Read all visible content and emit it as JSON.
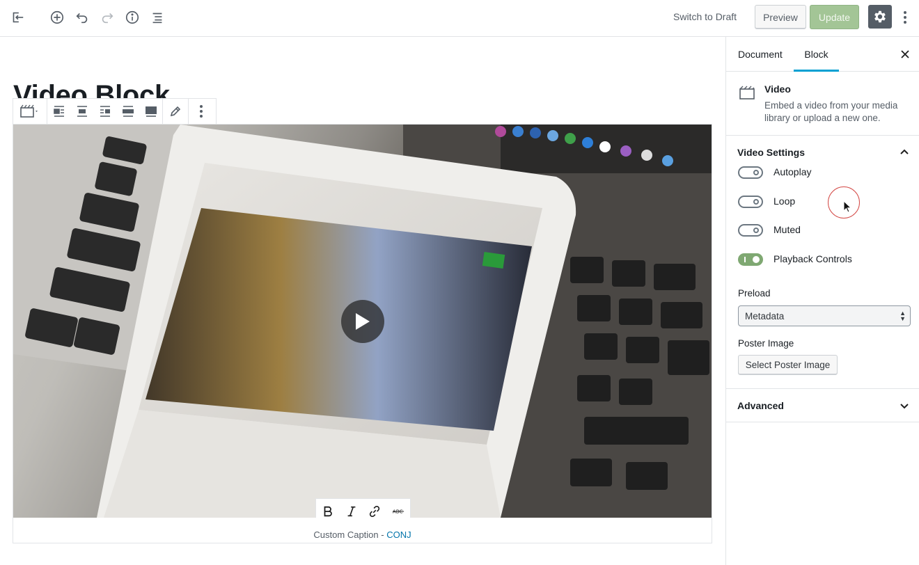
{
  "topbar": {
    "switch_to_draft": "Switch to Draft",
    "preview": "Preview",
    "update": "Update",
    "icons": [
      "back-icon",
      "add-block-icon",
      "undo-icon",
      "redo-icon",
      "info-icon",
      "outline-icon",
      "gear-icon",
      "more-vertical-icon"
    ]
  },
  "editor": {
    "post_title": "Video Block",
    "block_toolbar": [
      "video-icon",
      "align-left-icon",
      "align-center-icon",
      "align-right-icon",
      "wide-width-icon",
      "full-width-icon",
      "edit-pencil-icon",
      "more-vertical-icon"
    ],
    "caption_toolbar": [
      "bold-icon",
      "italic-icon",
      "link-icon",
      "strikethrough-icon"
    ],
    "caption_prefix": "Custom Caption - ",
    "caption_link": "CONJ"
  },
  "sidebar": {
    "tabs": [
      "Document",
      "Block"
    ],
    "active_tab": "Block",
    "block": {
      "name": "Video",
      "description": "Embed a video from your media library or upload a new one."
    },
    "video_settings": {
      "title": "Video Settings",
      "toggles": [
        {
          "label": "Autoplay",
          "on": false
        },
        {
          "label": "Loop",
          "on": false
        },
        {
          "label": "Muted",
          "on": false
        },
        {
          "label": "Playback Controls",
          "on": true
        }
      ],
      "preload_label": "Preload",
      "preload_value": "Metadata",
      "poster_label": "Poster Image",
      "poster_button": "Select Poster Image"
    },
    "advanced": {
      "title": "Advanced"
    }
  },
  "colors": {
    "accent_tab": "#00a0d2",
    "update_button": "#a3c596",
    "toggle_on": "#7fa872",
    "link": "#0073aa",
    "cursor_ring": "#d44a47"
  }
}
